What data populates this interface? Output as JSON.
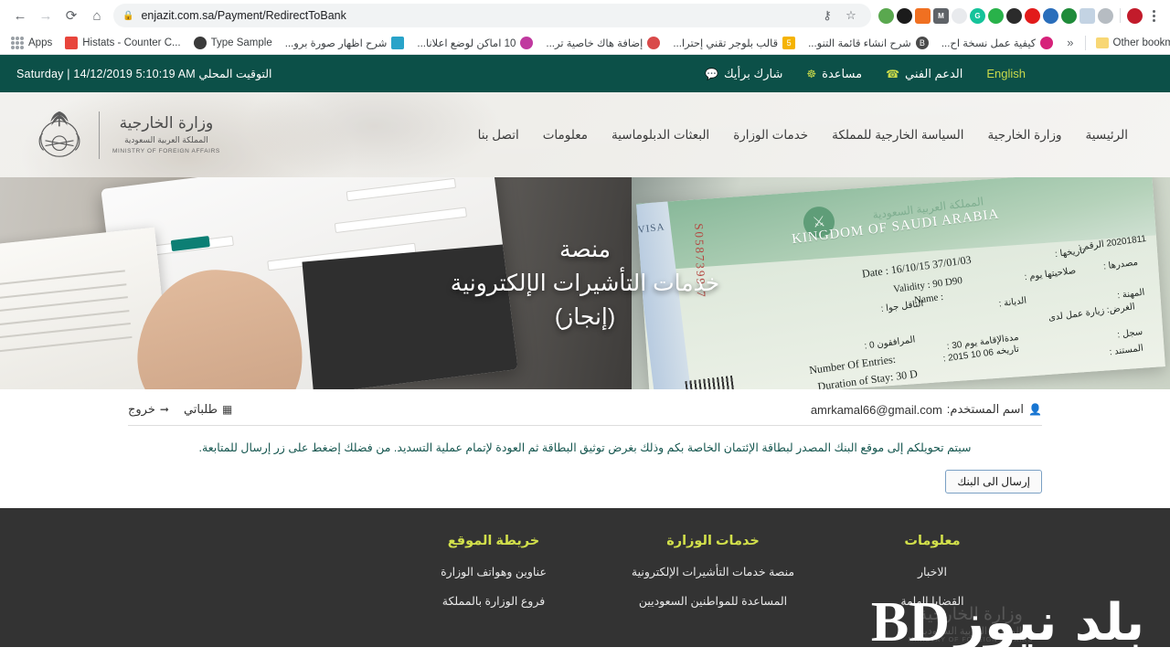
{
  "browser": {
    "url": "enjazit.com.sa/Payment/RedirectToBank",
    "back_label": "←",
    "forward_label": "→",
    "reload_label": "⟳",
    "home_label": "⌂",
    "lock_icon": "lock-icon",
    "key_icon": "key-icon",
    "star_label": "☆",
    "menu_label": "⋮",
    "bookmarks": [
      {
        "label": "Apps",
        "icon": "apps-grid-icon",
        "rtl": false,
        "color": "#9aa0a6"
      },
      {
        "label": "Histats - Counter C...",
        "icon": "bar-chart-icon",
        "rtl": false,
        "color": "#e8453c"
      },
      {
        "label": "Type Sample",
        "icon": "globe-icon",
        "rtl": false,
        "color": "#3a3a3a"
      },
      {
        "label": "شرح اظهار صورة برو...",
        "icon": "document-icon",
        "rtl": true,
        "color": "#29a3c9"
      },
      {
        "label": "10 اماكن لوضع اعلانا...",
        "icon": "star-burst-icon",
        "rtl": true,
        "color": "#c0399f"
      },
      {
        "label": "إضافة هاك خاصية تر...",
        "icon": "flower-icon",
        "rtl": true,
        "color": "#d94a4a"
      },
      {
        "label": "قالب بلوجر تقني إحترا...",
        "icon": "number-badge-icon",
        "rtl": true,
        "color": "#f5b301"
      },
      {
        "label": "شرح انشاء قائمة التنو...",
        "icon": "blogger-icon",
        "rtl": true,
        "color": "#4a4a4a"
      },
      {
        "label": "كيفية عمل نسخة اح...",
        "icon": "circle-o-icon",
        "rtl": true,
        "color": "#d6227a"
      }
    ],
    "overflow_label": "»",
    "other_bookmarks_label": "Other bookmarks",
    "extensions": [
      {
        "name": "lightbulb-badge-icon",
        "color": "#5aa84f",
        "glyph": "",
        "square": false
      },
      {
        "name": "dark-circle-icon",
        "color": "#1b1b1b",
        "glyph": "",
        "square": false
      },
      {
        "name": "orange-chart-icon",
        "color": "#f07021",
        "glyph": "",
        "square": true
      },
      {
        "name": "mailbox-m-icon",
        "color": "#5f6368",
        "glyph": "M",
        "square": true
      },
      {
        "name": "eraser-icon",
        "color": "#e8eaed",
        "glyph": "",
        "square": false
      },
      {
        "name": "grammarly-g-icon",
        "color": "#15c39a",
        "glyph": "G",
        "square": false
      },
      {
        "name": "green-thumb-icon",
        "color": "#29b24a",
        "glyph": "",
        "square": false
      },
      {
        "name": "yin-yang-icon",
        "color": "#2b2b2b",
        "glyph": "",
        "square": false
      },
      {
        "name": "opera-red-icon",
        "color": "#e21b1b",
        "glyph": "",
        "square": false
      },
      {
        "name": "sitemap-icon",
        "color": "#2a6ebb",
        "glyph": "",
        "square": false
      },
      {
        "name": "green-globe-icon",
        "color": "#1f8b3a",
        "glyph": "",
        "square": false
      },
      {
        "name": "notepad-icon",
        "color": "#c3d3e3",
        "glyph": "",
        "square": true
      },
      {
        "name": "grey-globe-icon",
        "color": "#b6bcc2",
        "glyph": "",
        "square": false
      },
      {
        "name": "red-seal-icon",
        "color": "#c21b2b",
        "glyph": "",
        "square": false
      }
    ]
  },
  "site": {
    "topbar": {
      "english_label": "English",
      "support_label": "الدعم الفني",
      "help_label": "مساعدة",
      "opinion_label": "شارك برأيك",
      "clock": "التوقيت المحلي Saturday | 14/12/2019 5:10:19 AM",
      "support_icon": "phone-icon",
      "help_icon": "life-ring-icon",
      "opinion_icon": "comment-icon",
      "bg_color": "#0c5048"
    },
    "nav": [
      {
        "label": "الرئيسية"
      },
      {
        "label": "وزارة الخارجية"
      },
      {
        "label": "السياسة الخارجية للمملكة"
      },
      {
        "label": "خدمات الوزارة"
      },
      {
        "label": "البعثات الدبلوماسية"
      },
      {
        "label": "معلومات"
      },
      {
        "label": "اتصل بنا"
      }
    ],
    "logo": {
      "arabic_title": "وزارة الخارجية",
      "arabic_sub": "المملكة العربية السعودية",
      "english": "MINISTRY OF FOREIGN AFFAIRS",
      "emblem_icon": "saudi-emblem-icon"
    },
    "hero": {
      "line1": "منصة",
      "line2": "خدمات التأشيرات الإلكترونية",
      "line3": "(إنجاز)",
      "visa": {
        "country_en": "KINGDOM OF SAUDI ARABIA",
        "country_ar": "المملكة العربية السعودية",
        "visa_edge_label": "VISA",
        "serial": "S0587399 7",
        "date_label": "Date :",
        "date_value": "16/10/15 37/01/03",
        "date_ar": "تاريخها :",
        "number_ar": "الرقم :",
        "number_value": "20201811",
        "validity_label": "Validity :",
        "validity_value": "90 D90",
        "validity_ar": "صلاحيتها  يوم :",
        "source_ar": "مصدرها :",
        "name_label": "Name :",
        "carrier_ar": "الناقل جوا :",
        "religion_ar": "الديانة :",
        "profession_ar": "المهنة :",
        "purpose_ar": "الغرض: زيارة عمل لدى",
        "companions_ar": "المرافقون 0 :",
        "stay_ar": "مدةالإقامة يوم 30 :",
        "issue_ar": "تاريخه 06 10 2015 :",
        "register_ar": "سجل :",
        "document_ar": "المستند :",
        "entries_label": "Number Of Entries:",
        "duration_label": "Duration of Stay:  30 D"
      }
    },
    "account": {
      "user_label": "اسم المستخدم:",
      "user_value": "amrkamal66@gmail.com",
      "user_icon": "user-icon",
      "orders_label": "طلباتي",
      "orders_icon": "list-icon",
      "logout_label": "خروج",
      "logout_icon": "sign-out-icon"
    },
    "notice": "سيتم تحويلكم إلى موقع البنك المصدر لبطاقة الإئتمان الخاصة بكم وذلك بغرض توثيق البطاقة ثم العودة لإتمام عملية التسديد. من فضلك إضغط على زر إرسال للمتابعة.",
    "send_button_label": "إرسال الى البنك",
    "footer": {
      "columns": [
        {
          "title": "خريطة الموقع",
          "links": [
            "عناوين وهواتف الوزارة",
            "فروع الوزارة بالمملكة"
          ]
        },
        {
          "title": "خدمات الوزارة",
          "links": [
            "منصة خدمات التأشيرات الإلكترونية",
            "المساعدة للمواطنين السعوديين"
          ]
        },
        {
          "title": "معلومات",
          "links": [
            "الاخبار",
            "القضايا الهامة"
          ]
        }
      ],
      "title_color": "#d2e04b",
      "bg_color": "#333333",
      "watermark_text": "بلد نيوز",
      "watermark_mono": "BD",
      "watermark_ghost_ar": "وزارة الخارجية",
      "watermark_ghost_sub": "المملكة العربية السعودية",
      "watermark_ghost_en": "MINISTRY OF FOREIGN AFFAIRS"
    }
  }
}
